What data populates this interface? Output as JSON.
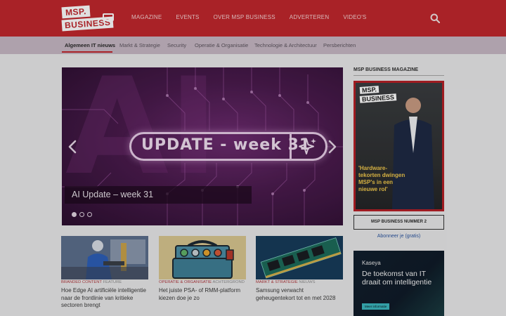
{
  "header": {
    "logo": {
      "line1": "MSP.",
      "line2": "BUSINESS"
    },
    "nav": [
      "MAGAZINE",
      "EVENTS",
      "OVER MSP BUSINESS",
      "ADVERTEREN",
      "VIDEO'S"
    ],
    "search_icon": "search-icon"
  },
  "subnav": {
    "items": [
      "Algemeen IT nieuws",
      "Markt & Strategie",
      "Security",
      "Operatie & Organisatie",
      "Technologie & Architectuur",
      "Persberichten"
    ],
    "active_index": 0
  },
  "hero": {
    "image_text": "UPDATE - week 31",
    "caption": "AI Update – week 31",
    "slide_count": 3,
    "active_slide": 0
  },
  "articles": [
    {
      "category": "BRANDED CONTENT",
      "type": "FEATURE",
      "title": "Hoe Edge AI artificiële intelligentie naar de frontlinie van kritieke sectoren brengt"
    },
    {
      "category": "OPERATIE & ORGANISATIE",
      "type": "ACHTERGROND",
      "title": "Het juiste PSA- of RMM-platform kiezen doe je zo"
    },
    {
      "category": "MARKT & STRATEGIE",
      "type": "NIEUWS",
      "title": "Samsung verwacht geheugentekort tot en met 2028"
    }
  ],
  "sidebar": {
    "title": "MSP BUSINESS MAGAZINE",
    "magazine": {
      "logo1": "MSP.",
      "logo2": "BUSINESS",
      "headline": "'Hardware-tekorten dwingen MSP's in een nieuwe rol'"
    },
    "issue_button": "MSP BUSINESS NUMMER 2",
    "subscribe_link": "Abonneer je (gratis)",
    "ad": {
      "brand": "Kaseya",
      "text": "De toekomst van IT draait om intelligentie",
      "button": "Meer informatie"
    }
  },
  "colors": {
    "brand_red": "#c1272d",
    "subnav_bg": "#c7b8c4",
    "page_bg": "#e9e9ea",
    "tag_red": "#b03a3f",
    "link_blue": "#2b55a0"
  }
}
